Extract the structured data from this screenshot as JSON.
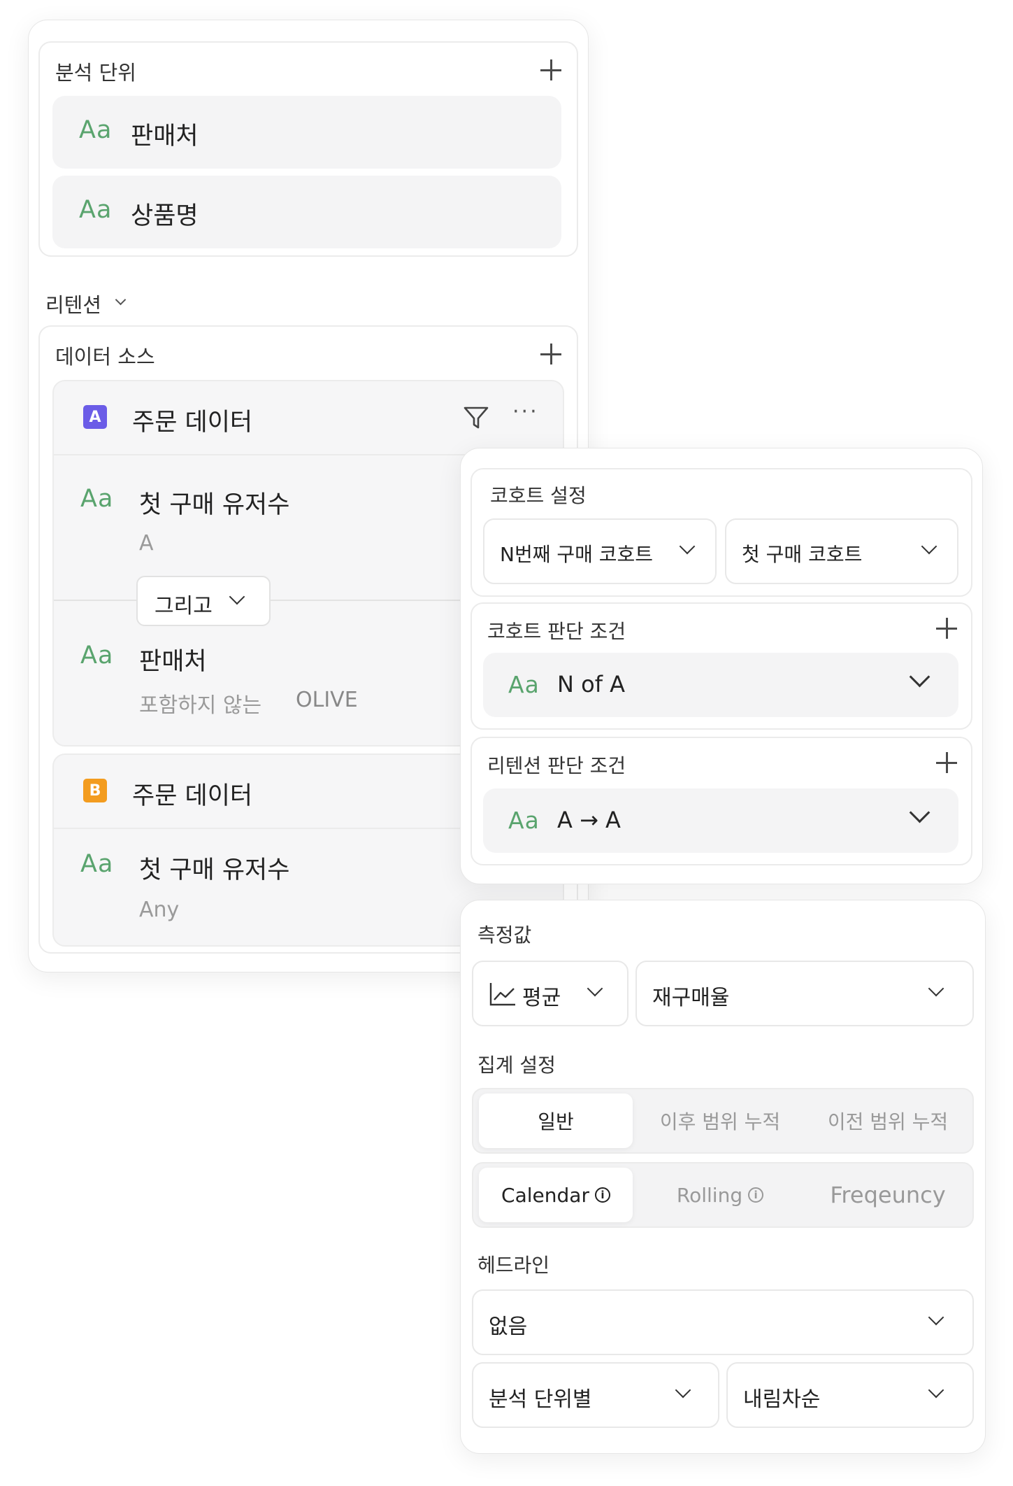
{
  "left_panel": {
    "analysis_unit": {
      "label": "분석 단위",
      "items": [
        {
          "type_icon": "Aa",
          "label": "판매처"
        },
        {
          "type_icon": "Aa",
          "label": "상품명"
        }
      ]
    },
    "retention_dropdown": "리텐션",
    "data_source": {
      "label": "데이터 소스",
      "sources": [
        {
          "badge": "A",
          "badge_color": "#6b5ce7",
          "name": "주문 데이터",
          "conditions": [
            {
              "type_icon": "Aa",
              "label": "첫 구매 유저수",
              "detail": "A"
            },
            {
              "type_icon": "Aa",
              "label": "판매처",
              "operator": "포함하지 않는",
              "value": "OLIVE"
            }
          ],
          "connector": "그리고"
        },
        {
          "badge": "B",
          "badge_color": "#f39c1f",
          "name": "주문 데이터",
          "conditions": [
            {
              "type_icon": "Aa",
              "label": "첫 구매 유저수",
              "detail": "Any"
            }
          ]
        }
      ]
    }
  },
  "cohort_panel": {
    "cohort_settings": {
      "label": "코호트 설정",
      "select_1": "N번째 구매 코호트",
      "select_2": "첫 구매 코호트"
    },
    "cohort_condition": {
      "label": "코호트 판단 조건",
      "type_icon": "Aa",
      "value": "N of A"
    },
    "retention_condition": {
      "label": "리텐션 판단 조건",
      "type_icon": "Aa",
      "value": "A → A"
    }
  },
  "measure_panel": {
    "measure": {
      "label": "측정값",
      "aggregation": "평균",
      "aggregation_icon": "line-chart-icon",
      "metric": "재구매율"
    },
    "aggregate_settings": {
      "label": "집계 설정",
      "mode_tabs": [
        "일반",
        "이후 범위 누적",
        "이전 범위 누적"
      ],
      "mode_active": "일반",
      "period_tabs": [
        "Calendar",
        "Rolling",
        "Freqeuncy"
      ],
      "period_active": "Calendar"
    },
    "headline": {
      "label": "헤드라인",
      "value": "없음",
      "group_by": "분석 단위별",
      "sort": "내림차순"
    }
  },
  "colors": {
    "type_icon": "#5aa46e",
    "badge_a": "#6b5ce7",
    "badge_b": "#f39c1f",
    "muted_text": "#9a9a9a"
  }
}
